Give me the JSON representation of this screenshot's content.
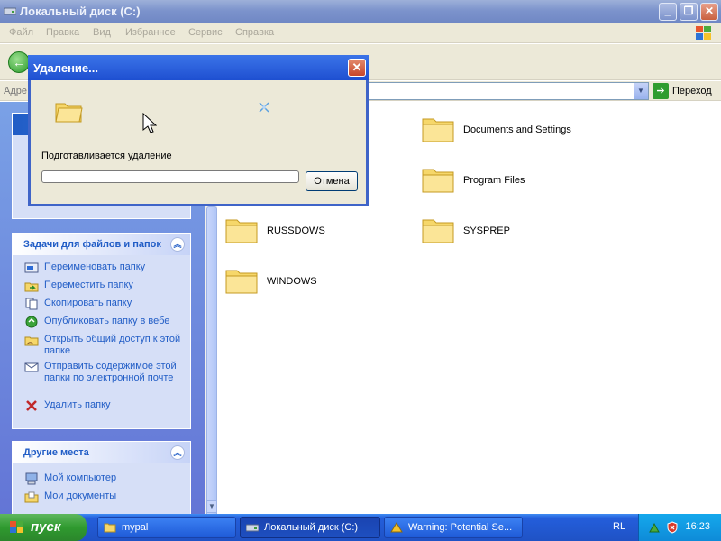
{
  "window": {
    "title": "Локальный диск (C:)"
  },
  "menu": [
    "Файл",
    "Правка",
    "Вид",
    "Избранное",
    "Сервис",
    "Справка"
  ],
  "address": {
    "label": "Адре",
    "go_label": "Переход"
  },
  "left_pane": {
    "file_tasks": {
      "title": "Задачи для файлов и папок",
      "items": [
        "Переименовать папку",
        "Переместить папку",
        "Скопировать папку",
        "Опубликовать папку в вебе",
        "Открыть общий доступ к этой папке",
        "Отправить содержимое этой папки по электронной почте",
        "Удалить папку"
      ]
    },
    "other_places": {
      "title": "Другие места",
      "items": [
        "Мой компьютер",
        "Мои документы"
      ]
    }
  },
  "folders": [
    {
      "name": "Documents and Settings"
    },
    {
      "name": "Program Files"
    },
    {
      "name": "RUSSDOWS"
    },
    {
      "name": "SYSPREP"
    },
    {
      "name": "WINDOWS"
    }
  ],
  "dialog": {
    "title": "Удаление...",
    "status": "Подготавливается удаление",
    "progress": 0,
    "cancel_label": "Отмена"
  },
  "taskbar": {
    "start_label": "пуск",
    "tasks": [
      "mypal",
      "Локальный диск (C:)",
      "Warning: Potential Se..."
    ],
    "lang": "RL",
    "clock": "16:23"
  },
  "colors": {
    "title_active": "#1e4fd1",
    "taskpane_link": "#215dc6",
    "folder_yellow": "#f6d76a"
  }
}
